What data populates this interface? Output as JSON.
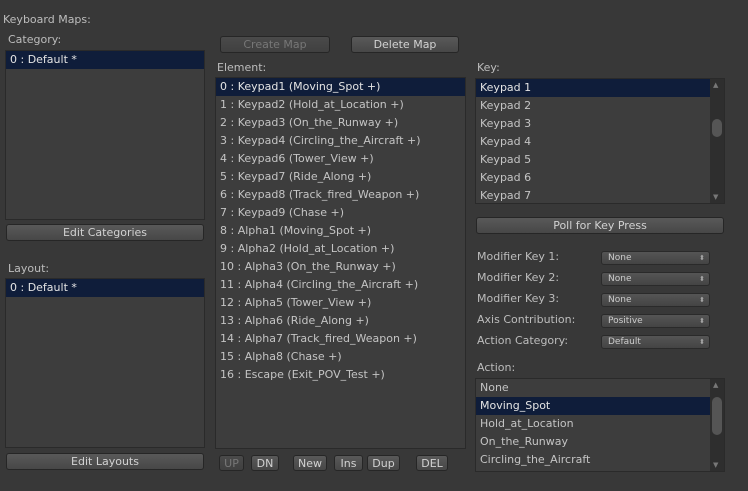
{
  "title": "Keyboard Maps:",
  "category": {
    "label": "Category:",
    "items": [
      "0 : Default *"
    ],
    "selected": 0,
    "edit_button": "Edit Categories"
  },
  "layout": {
    "label": "Layout:",
    "items": [
      "0 : Default *"
    ],
    "selected": 0,
    "edit_button": "Edit Layouts"
  },
  "map_buttons": {
    "create": "Create Map",
    "delete": "Delete Map"
  },
  "element": {
    "label": "Element:",
    "selected": 0,
    "items": [
      "0 : Keypad1  (Moving_Spot +)",
      "1 : Keypad2  (Hold_at_Location +)",
      "2 : Keypad3  (On_the_Runway +)",
      "3 : Keypad4  (Circling_the_Aircraft +)",
      "4 : Keypad6  (Tower_View +)",
      "5 : Keypad7  (Ride_Along +)",
      "6 : Keypad8  (Track_fired_Weapon +)",
      "7 : Keypad9  (Chase +)",
      "8 : Alpha1  (Moving_Spot +)",
      "9 : Alpha2  (Hold_at_Location +)",
      "10 : Alpha3  (On_the_Runway +)",
      "11 : Alpha4  (Circling_the_Aircraft +)",
      "12 : Alpha5  (Tower_View +)",
      "13 : Alpha6  (Ride_Along +)",
      "14 : Alpha7  (Track_fired_Weapon +)",
      "15 : Alpha8  (Chase +)",
      "16 : Escape  (Exit_POV_Test +)"
    ],
    "buttons": {
      "up": "UP",
      "dn": "DN",
      "new": "New",
      "ins": "Ins",
      "dup": "Dup",
      "del": "DEL"
    }
  },
  "key": {
    "label": "Key:",
    "selected": 0,
    "items": [
      "Keypad 1",
      "Keypad 2",
      "Keypad 3",
      "Keypad 4",
      "Keypad 5",
      "Keypad 6",
      "Keypad 7"
    ],
    "poll_button": "Poll for Key Press"
  },
  "fields": [
    {
      "label": "Modifier Key 1:",
      "value": "None"
    },
    {
      "label": "Modifier Key 2:",
      "value": "None"
    },
    {
      "label": "Modifier Key 3:",
      "value": "None"
    },
    {
      "label": "Axis Contribution:",
      "value": "Positive"
    },
    {
      "label": "Action Category:",
      "value": "Default"
    }
  ],
  "action": {
    "label": "Action:",
    "selected": 1,
    "items": [
      "None",
      "Moving_Spot",
      "Hold_at_Location",
      "On_the_Runway",
      "Circling_the_Aircraft"
    ]
  }
}
